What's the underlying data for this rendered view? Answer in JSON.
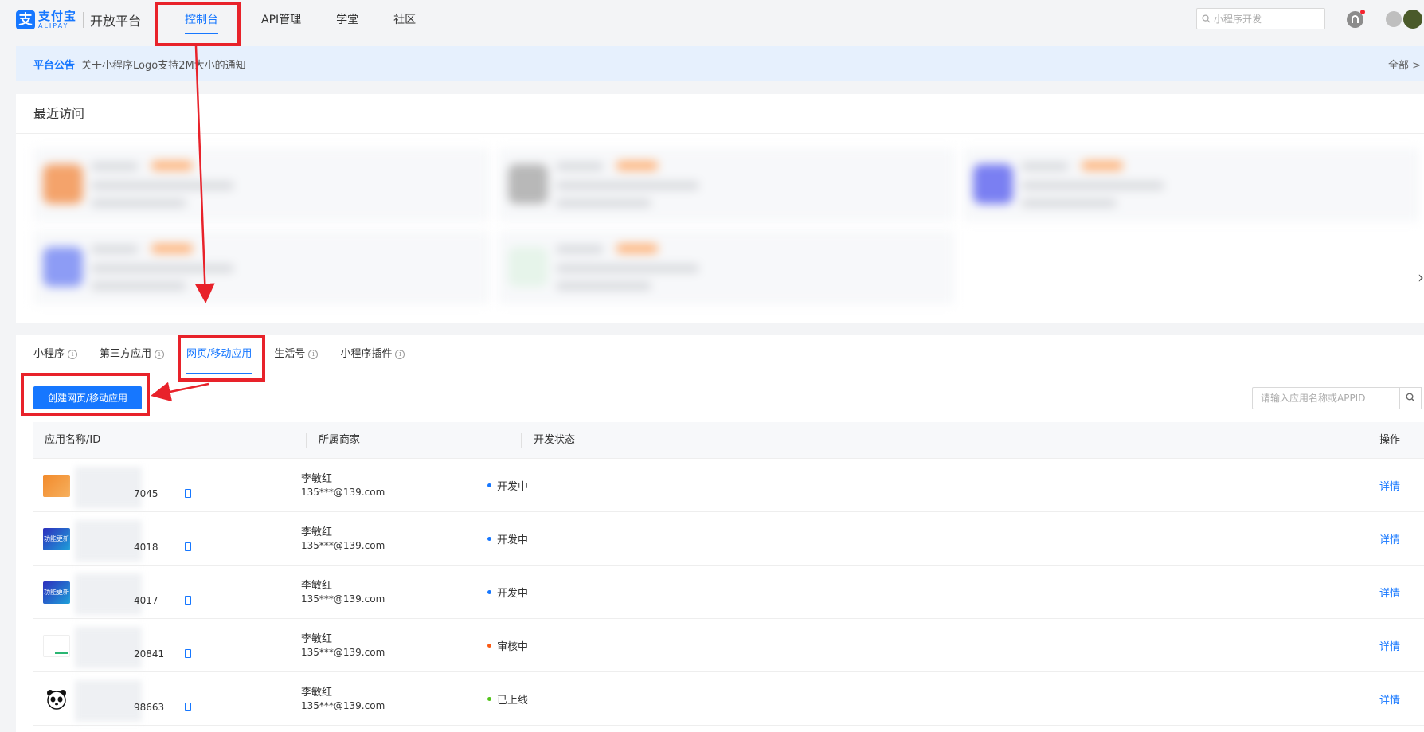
{
  "header": {
    "logo_mark": "支",
    "logo_cn": "支付宝",
    "logo_en": "ALIPAY",
    "platform": "开放平台",
    "nav": [
      {
        "label": "控制台",
        "active": true
      },
      {
        "label": "API管理",
        "active": false
      },
      {
        "label": "学堂",
        "active": false
      },
      {
        "label": "社区",
        "active": false
      }
    ],
    "search_placeholder": "小程序开发",
    "search_icon": "search-icon",
    "bell_icon": "bell-icon"
  },
  "notice": {
    "label": "平台公告",
    "text": "关于小程序Logo支持2M大小的通知",
    "all": "全部 >"
  },
  "recent": {
    "title": "最近访问",
    "next": "›"
  },
  "tabs": [
    {
      "label": "小程序",
      "info": true,
      "active": false
    },
    {
      "label": "第三方应用",
      "info": true,
      "active": false
    },
    {
      "label": "网页/移动应用",
      "info": false,
      "active": true
    },
    {
      "label": "生活号",
      "info": true,
      "active": false
    },
    {
      "label": "小程序插件",
      "info": true,
      "active": false
    }
  ],
  "actions": {
    "create_label": "创建网页/移动应用",
    "search_placeholder": "请输入应用名称或APPID"
  },
  "table": {
    "headers": [
      "应用名称/ID",
      "所属商家",
      "开发状态",
      "操作"
    ],
    "rows": [
      {
        "thumb": "orange",
        "thumb_text": "",
        "id_suffix": "7045",
        "merchant": "李敏红",
        "mail": "135***@139.com",
        "status": "开发中",
        "status_color": "#1677ff",
        "action": "详情"
      },
      {
        "thumb": "purple",
        "thumb_text": "功能更新",
        "id_suffix": "4018",
        "merchant": "李敏红",
        "mail": "135***@139.com",
        "status": "开发中",
        "status_color": "#1677ff",
        "action": "详情"
      },
      {
        "thumb": "purple",
        "thumb_text": "功能更新",
        "id_suffix": "4017",
        "merchant": "李敏红",
        "mail": "135***@139.com",
        "status": "开发中",
        "status_color": "#1677ff",
        "action": "详情"
      },
      {
        "thumb": "white",
        "thumb_text": "",
        "id_suffix": "20841",
        "merchant": "李敏红",
        "mail": "135***@139.com",
        "status": "审核中",
        "status_color": "#fa5a14",
        "action": "详情"
      },
      {
        "thumb": "panda",
        "thumb_text": "",
        "id_suffix": "98663",
        "merchant": "李敏红",
        "mail": "135***@139.com",
        "status": "已上线",
        "status_color": "#52c41a",
        "action": "详情"
      }
    ]
  },
  "colors": {
    "accent": "#1677ff",
    "annotation": "#e8222a"
  }
}
